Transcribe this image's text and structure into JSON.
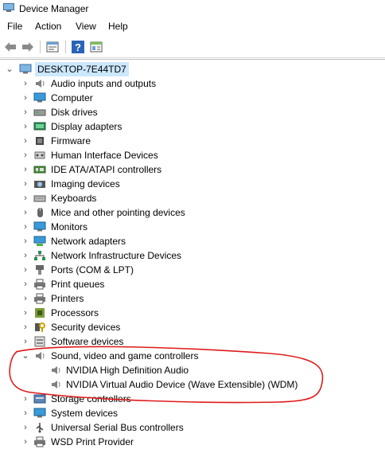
{
  "window": {
    "title": "Device Manager"
  },
  "menu": [
    {
      "label": "File"
    },
    {
      "label": "Action"
    },
    {
      "label": "View"
    },
    {
      "label": "Help"
    }
  ],
  "toolbar": [
    {
      "name": "back-button",
      "icon": "back-arrow-icon"
    },
    {
      "name": "forward-button",
      "icon": "forward-arrow-icon"
    },
    {
      "name": "properties-button",
      "icon": "properties-icon"
    },
    {
      "name": "help-button",
      "icon": "help-icon"
    },
    {
      "name": "view-toggle-button",
      "icon": "view-icon"
    }
  ],
  "tree": {
    "root": {
      "label": "DESKTOP-7E44TD7",
      "expanded": true
    },
    "nodes": [
      {
        "label": "Audio inputs and outputs",
        "icon": "speaker-icon",
        "expanded": false
      },
      {
        "label": "Computer",
        "icon": "monitor-icon",
        "expanded": false
      },
      {
        "label": "Disk drives",
        "icon": "disk-icon",
        "expanded": false
      },
      {
        "label": "Display adapters",
        "icon": "display-adapter-icon",
        "expanded": false
      },
      {
        "label": "Firmware",
        "icon": "chip-icon",
        "expanded": false
      },
      {
        "label": "Human Interface Devices",
        "icon": "hid-icon",
        "expanded": false
      },
      {
        "label": "IDE ATA/ATAPI controllers",
        "icon": "controller-icon",
        "expanded": false
      },
      {
        "label": "Imaging devices",
        "icon": "camera-icon",
        "expanded": false
      },
      {
        "label": "Keyboards",
        "icon": "keyboard-icon",
        "expanded": false
      },
      {
        "label": "Mice and other pointing devices",
        "icon": "mouse-icon",
        "expanded": false
      },
      {
        "label": "Monitors",
        "icon": "monitor-icon",
        "expanded": false
      },
      {
        "label": "Network adapters",
        "icon": "network-icon",
        "expanded": false
      },
      {
        "label": "Network Infrastructure Devices",
        "icon": "network-infra-icon",
        "expanded": false
      },
      {
        "label": "Ports (COM & LPT)",
        "icon": "port-icon",
        "expanded": false
      },
      {
        "label": "Print queues",
        "icon": "printer-icon",
        "expanded": false
      },
      {
        "label": "Printers",
        "icon": "printer-icon",
        "expanded": false
      },
      {
        "label": "Processors",
        "icon": "processor-icon",
        "expanded": false
      },
      {
        "label": "Security devices",
        "icon": "security-icon",
        "expanded": false
      },
      {
        "label": "Software devices",
        "icon": "software-icon",
        "expanded": false
      },
      {
        "label": "Sound, video and game controllers",
        "icon": "speaker-icon",
        "expanded": true,
        "children": [
          {
            "label": "NVIDIA High Definition Audio",
            "icon": "speaker-icon"
          },
          {
            "label": "NVIDIA Virtual Audio Device (Wave Extensible) (WDM)",
            "icon": "speaker-icon"
          }
        ]
      },
      {
        "label": "Storage controllers",
        "icon": "storage-icon",
        "expanded": false
      },
      {
        "label": "System devices",
        "icon": "system-icon",
        "expanded": false
      },
      {
        "label": "Universal Serial Bus controllers",
        "icon": "usb-icon",
        "expanded": false
      },
      {
        "label": "WSD Print Provider",
        "icon": "printer-icon",
        "expanded": false
      }
    ]
  },
  "colors": {
    "selection": "#cce8ff",
    "annotation": "#e01b1b"
  }
}
